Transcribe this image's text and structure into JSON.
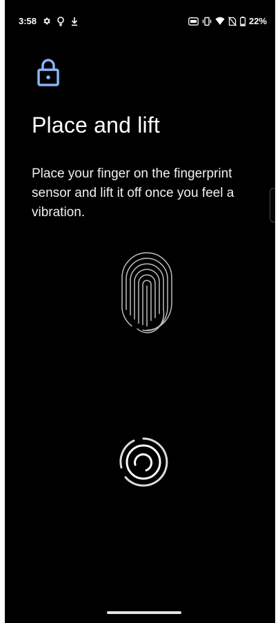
{
  "status_bar": {
    "time": "3:58",
    "battery": "22%",
    "icons_left": [
      "gear-icon",
      "bulb-icon",
      "download-icon"
    ],
    "icons_right": [
      "hd-icon",
      "vibrate-icon",
      "wifi-icon",
      "no-sim-icon",
      "battery-icon"
    ]
  },
  "lock_icon_color": "#8ab4f8",
  "header": {
    "title": "Place and lift"
  },
  "body": {
    "description": "Place your finger on the fingerprint sensor and lift it off once you feel a vibration."
  },
  "nav": {
    "handle": "home-indicator"
  }
}
